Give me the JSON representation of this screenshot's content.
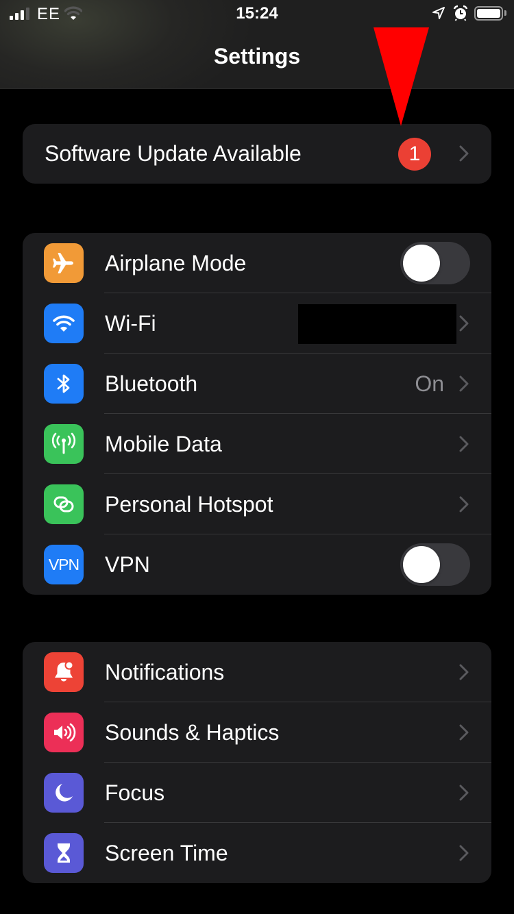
{
  "status_bar": {
    "carrier": "EE",
    "time": "15:24",
    "signal_bars_filled": 3,
    "signal_bars_total": 4,
    "wifi_strength_arcs": 1,
    "icons": [
      "signal-icon",
      "wifi-icon",
      "location-arrow-icon",
      "alarm-icon",
      "battery-icon"
    ],
    "battery_level": 1.0
  },
  "nav": {
    "title": "Settings"
  },
  "software_update": {
    "label": "Software Update Available",
    "badge_count": "1",
    "badge_color": "#eb4034"
  },
  "annotation": {
    "type": "red-arrow-pointing-down",
    "color": "#ff0000",
    "target": "software-update-badge"
  },
  "groups": [
    {
      "items": [
        {
          "label": "Airplane Mode",
          "icon": "airplane-icon",
          "icon_color": "#f19a37",
          "accessory": "toggle",
          "toggle_on": false
        },
        {
          "label": "Wi-Fi",
          "icon": "wifi-icon",
          "icon_color": "#1f7cf6",
          "accessory": "chevron",
          "value": "",
          "value_redacted": true
        },
        {
          "label": "Bluetooth",
          "icon": "bluetooth-icon",
          "icon_color": "#1f7cf6",
          "accessory": "chevron",
          "value": "On"
        },
        {
          "label": "Mobile Data",
          "icon": "antenna-icon",
          "icon_color": "#3ac35a",
          "accessory": "chevron"
        },
        {
          "label": "Personal Hotspot",
          "icon": "hotspot-link-icon",
          "icon_color": "#3ac35a",
          "accessory": "chevron"
        },
        {
          "label": "VPN",
          "icon": "vpn-icon",
          "icon_text": "VPN",
          "icon_color": "#1f7cf6",
          "accessory": "toggle",
          "toggle_on": false
        }
      ]
    },
    {
      "items": [
        {
          "label": "Notifications",
          "icon": "notification-bell-icon",
          "icon_color": "#ed4336",
          "accessory": "chevron"
        },
        {
          "label": "Sounds & Haptics",
          "icon": "speaker-icon",
          "icon_color": "#ec2f57",
          "accessory": "chevron"
        },
        {
          "label": "Focus",
          "icon": "moon-icon",
          "icon_color": "#5a59d6",
          "accessory": "chevron"
        },
        {
          "label": "Screen Time",
          "icon": "hourglass-icon",
          "icon_color": "#5a59d6",
          "accessory": "chevron"
        }
      ]
    }
  ]
}
